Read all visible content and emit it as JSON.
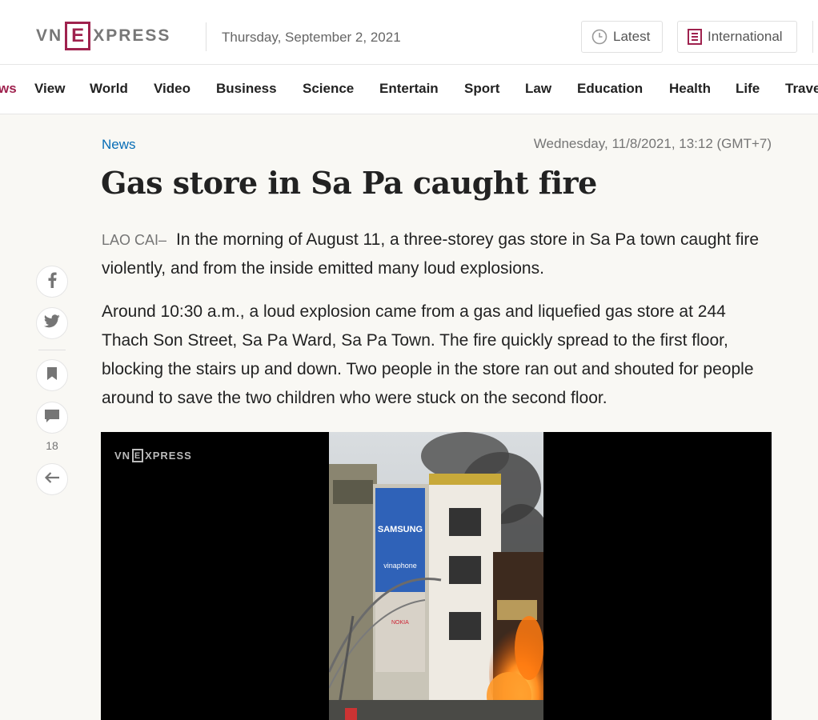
{
  "header": {
    "logo_left": "VN",
    "logo_box": "E",
    "logo_right": "XPRESS",
    "date": "Thursday, September 2, 2021",
    "latest_label": "Latest",
    "international_label": "International"
  },
  "nav": {
    "items": [
      "ws",
      "View",
      "World",
      "Video",
      "Business",
      "Science",
      "Entertain",
      "Sport",
      "Law",
      "Education",
      "Health",
      "Life",
      "Trave"
    ]
  },
  "article": {
    "category": "News",
    "published": "Wednesday, 11/8/2021, 13:12 (GMT+7)",
    "title": "Gas store in Sa Pa caught fire",
    "location": "LAO CAI–",
    "lead": "In the morning of August 11, a three-storey gas store in Sa Pa town caught fire violently, and from the inside emitted many loud explosions.",
    "paragraph": "Around 10:30 a.m., a loud explosion came from a gas and liquefied gas store at 244 Thach Son Street, Sa Pa Ward, Sa Pa Town. The fire quickly spread to the first floor, blocking the stairs up and down. Two people in the store ran out and shouted for people around to save the two children who were stuck on the second floor."
  },
  "social": {
    "comment_count": "18",
    "icons": [
      "facebook-icon",
      "twitter-icon",
      "bookmark-icon",
      "comment-icon",
      "back-arrow-icon"
    ]
  },
  "video": {
    "logo_left": "VN",
    "logo_box": "E",
    "logo_right": "XPRESS",
    "signs": [
      "SAMSUNG",
      "vinaphone",
      "NOKIA"
    ]
  },
  "colors": {
    "brand": "#9f224e",
    "link": "#076db6",
    "background": "#f9f8f4"
  }
}
